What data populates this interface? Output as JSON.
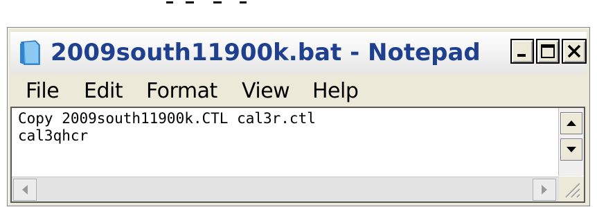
{
  "window": {
    "title": "2009south11900k.bat - Notepad",
    "icon": "notepad-icon",
    "controls": {
      "minimize": "minimize-icon",
      "maximize": "maximize-icon",
      "close": "close-icon"
    }
  },
  "menu": {
    "items": [
      {
        "label": "File"
      },
      {
        "label": "Edit"
      },
      {
        "label": "Format"
      },
      {
        "label": "View"
      },
      {
        "label": "Help"
      }
    ]
  },
  "editor": {
    "lines": [
      "Copy 2009south11900k.CTL cal3r.ctl",
      "cal3qhcr"
    ]
  },
  "colors": {
    "title_text": "#1f3f8f",
    "window_bg": "#ece9d8",
    "editor_bg": "#ffffff"
  }
}
